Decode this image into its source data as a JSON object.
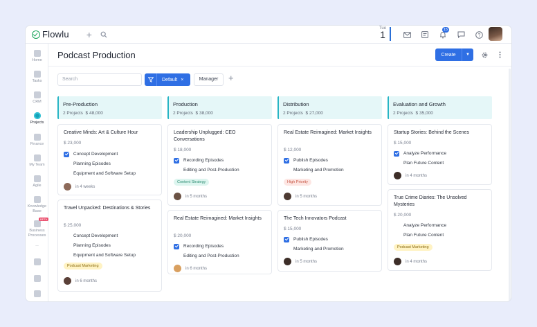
{
  "app": {
    "name": "Flowlu"
  },
  "topbar": {
    "date_day": "Tue",
    "date_num": "1",
    "notifications_badge": "15"
  },
  "sidebar": {
    "items": [
      {
        "label": "Home"
      },
      {
        "label": "Tasks"
      },
      {
        "label": "CRM"
      },
      {
        "label": "Projects"
      },
      {
        "label": "Finance"
      },
      {
        "label": "My Team"
      },
      {
        "label": "Agile"
      },
      {
        "label": "Knowledge Base"
      },
      {
        "label": "Business Processes",
        "badge": "BETA"
      },
      {
        "label": "..."
      }
    ]
  },
  "header": {
    "title": "Podcast Production",
    "create_label": "Create"
  },
  "filters": {
    "search_placeholder": "Search",
    "active_filter": "Default",
    "clear": "×",
    "manager": "Manager",
    "add": "+"
  },
  "columns": [
    {
      "name": "Pre-Production",
      "projects": "2 Projects",
      "amount": "$ 48,000",
      "cards": [
        {
          "title": "Creative Minds: Art & Culture Hour",
          "price": "$ 23,000",
          "tasks": [
            {
              "label": "Concept Development",
              "done": true
            },
            {
              "label": "Planning Episodes",
              "done": false
            },
            {
              "label": "Equipment and Software Setup",
              "done": false
            }
          ],
          "tag": null,
          "due": "in 4 weeks"
        },
        {
          "title": "Travel Unpacked: Destinations & Stories",
          "price": "$ 25,000",
          "tasks": [
            {
              "label": "Concept Development",
              "done": false
            },
            {
              "label": "Planning Episodes",
              "done": false
            },
            {
              "label": "Equipment and Software Setup",
              "done": false
            }
          ],
          "tag": "Podcast Marketing",
          "due": "in 6 months"
        }
      ]
    },
    {
      "name": "Production",
      "projects": "2 Projects",
      "amount": "$ 38,000",
      "cards": [
        {
          "title": "Leadership Unplugged: CEO Conversations",
          "price": "$ 18,000",
          "tasks": [
            {
              "label": "Recording Episodes",
              "done": true
            },
            {
              "label": "Editing and Post-Production",
              "done": false
            }
          ],
          "tag": "Content Strategy",
          "due": "in 5 months"
        },
        {
          "title": "Real Estate Reimagined: Market Insights",
          "price": "$ 20,000",
          "tasks": [
            {
              "label": "Recording Episodes",
              "done": true
            },
            {
              "label": "Editing and Post-Production",
              "done": false
            }
          ],
          "tag": null,
          "due": "in 6 months"
        }
      ]
    },
    {
      "name": "Distribution",
      "projects": "2 Projects",
      "amount": "$ 27,000",
      "cards": [
        {
          "title": "Real Estate Reimagined: Market Insights",
          "price": "$ 12,000",
          "tasks": [
            {
              "label": "Publish Episodes",
              "done": true
            },
            {
              "label": "Marketing and Promotion",
              "done": false
            }
          ],
          "tag": "High Priority",
          "due": "in 5 months"
        },
        {
          "title": "The Tech Innovators Podcast",
          "price": "$ 15,000",
          "tasks": [
            {
              "label": "Publish Episodes",
              "done": true
            },
            {
              "label": "Marketing and Promotion",
              "done": false
            }
          ],
          "tag": null,
          "due": "in 5 months"
        }
      ]
    },
    {
      "name": "Evaluation and Growth",
      "projects": "2 Projects",
      "amount": "$ 35,000",
      "cards": [
        {
          "title": "Startup Stories: Behind the Scenes",
          "price": "$ 15,000",
          "tasks": [
            {
              "label": "Analyze Performance",
              "done": true
            },
            {
              "label": "Plan Future Content",
              "done": false
            }
          ],
          "tag": null,
          "due": "in 4 months"
        },
        {
          "title": "True Crime Diaries: The Unsolved Mysteries",
          "price": "$ 20,000",
          "tasks": [
            {
              "label": "Analyze Performance",
              "done": false
            },
            {
              "label": "Plan Future Content",
              "done": false
            }
          ],
          "tag": "Podcast Marketing",
          "due": "in 4 months"
        }
      ]
    }
  ],
  "colors": {
    "accent": "#2f6fe4",
    "column_header_bg": "#e5f7f8",
    "column_header_border": "#27b5c4"
  }
}
